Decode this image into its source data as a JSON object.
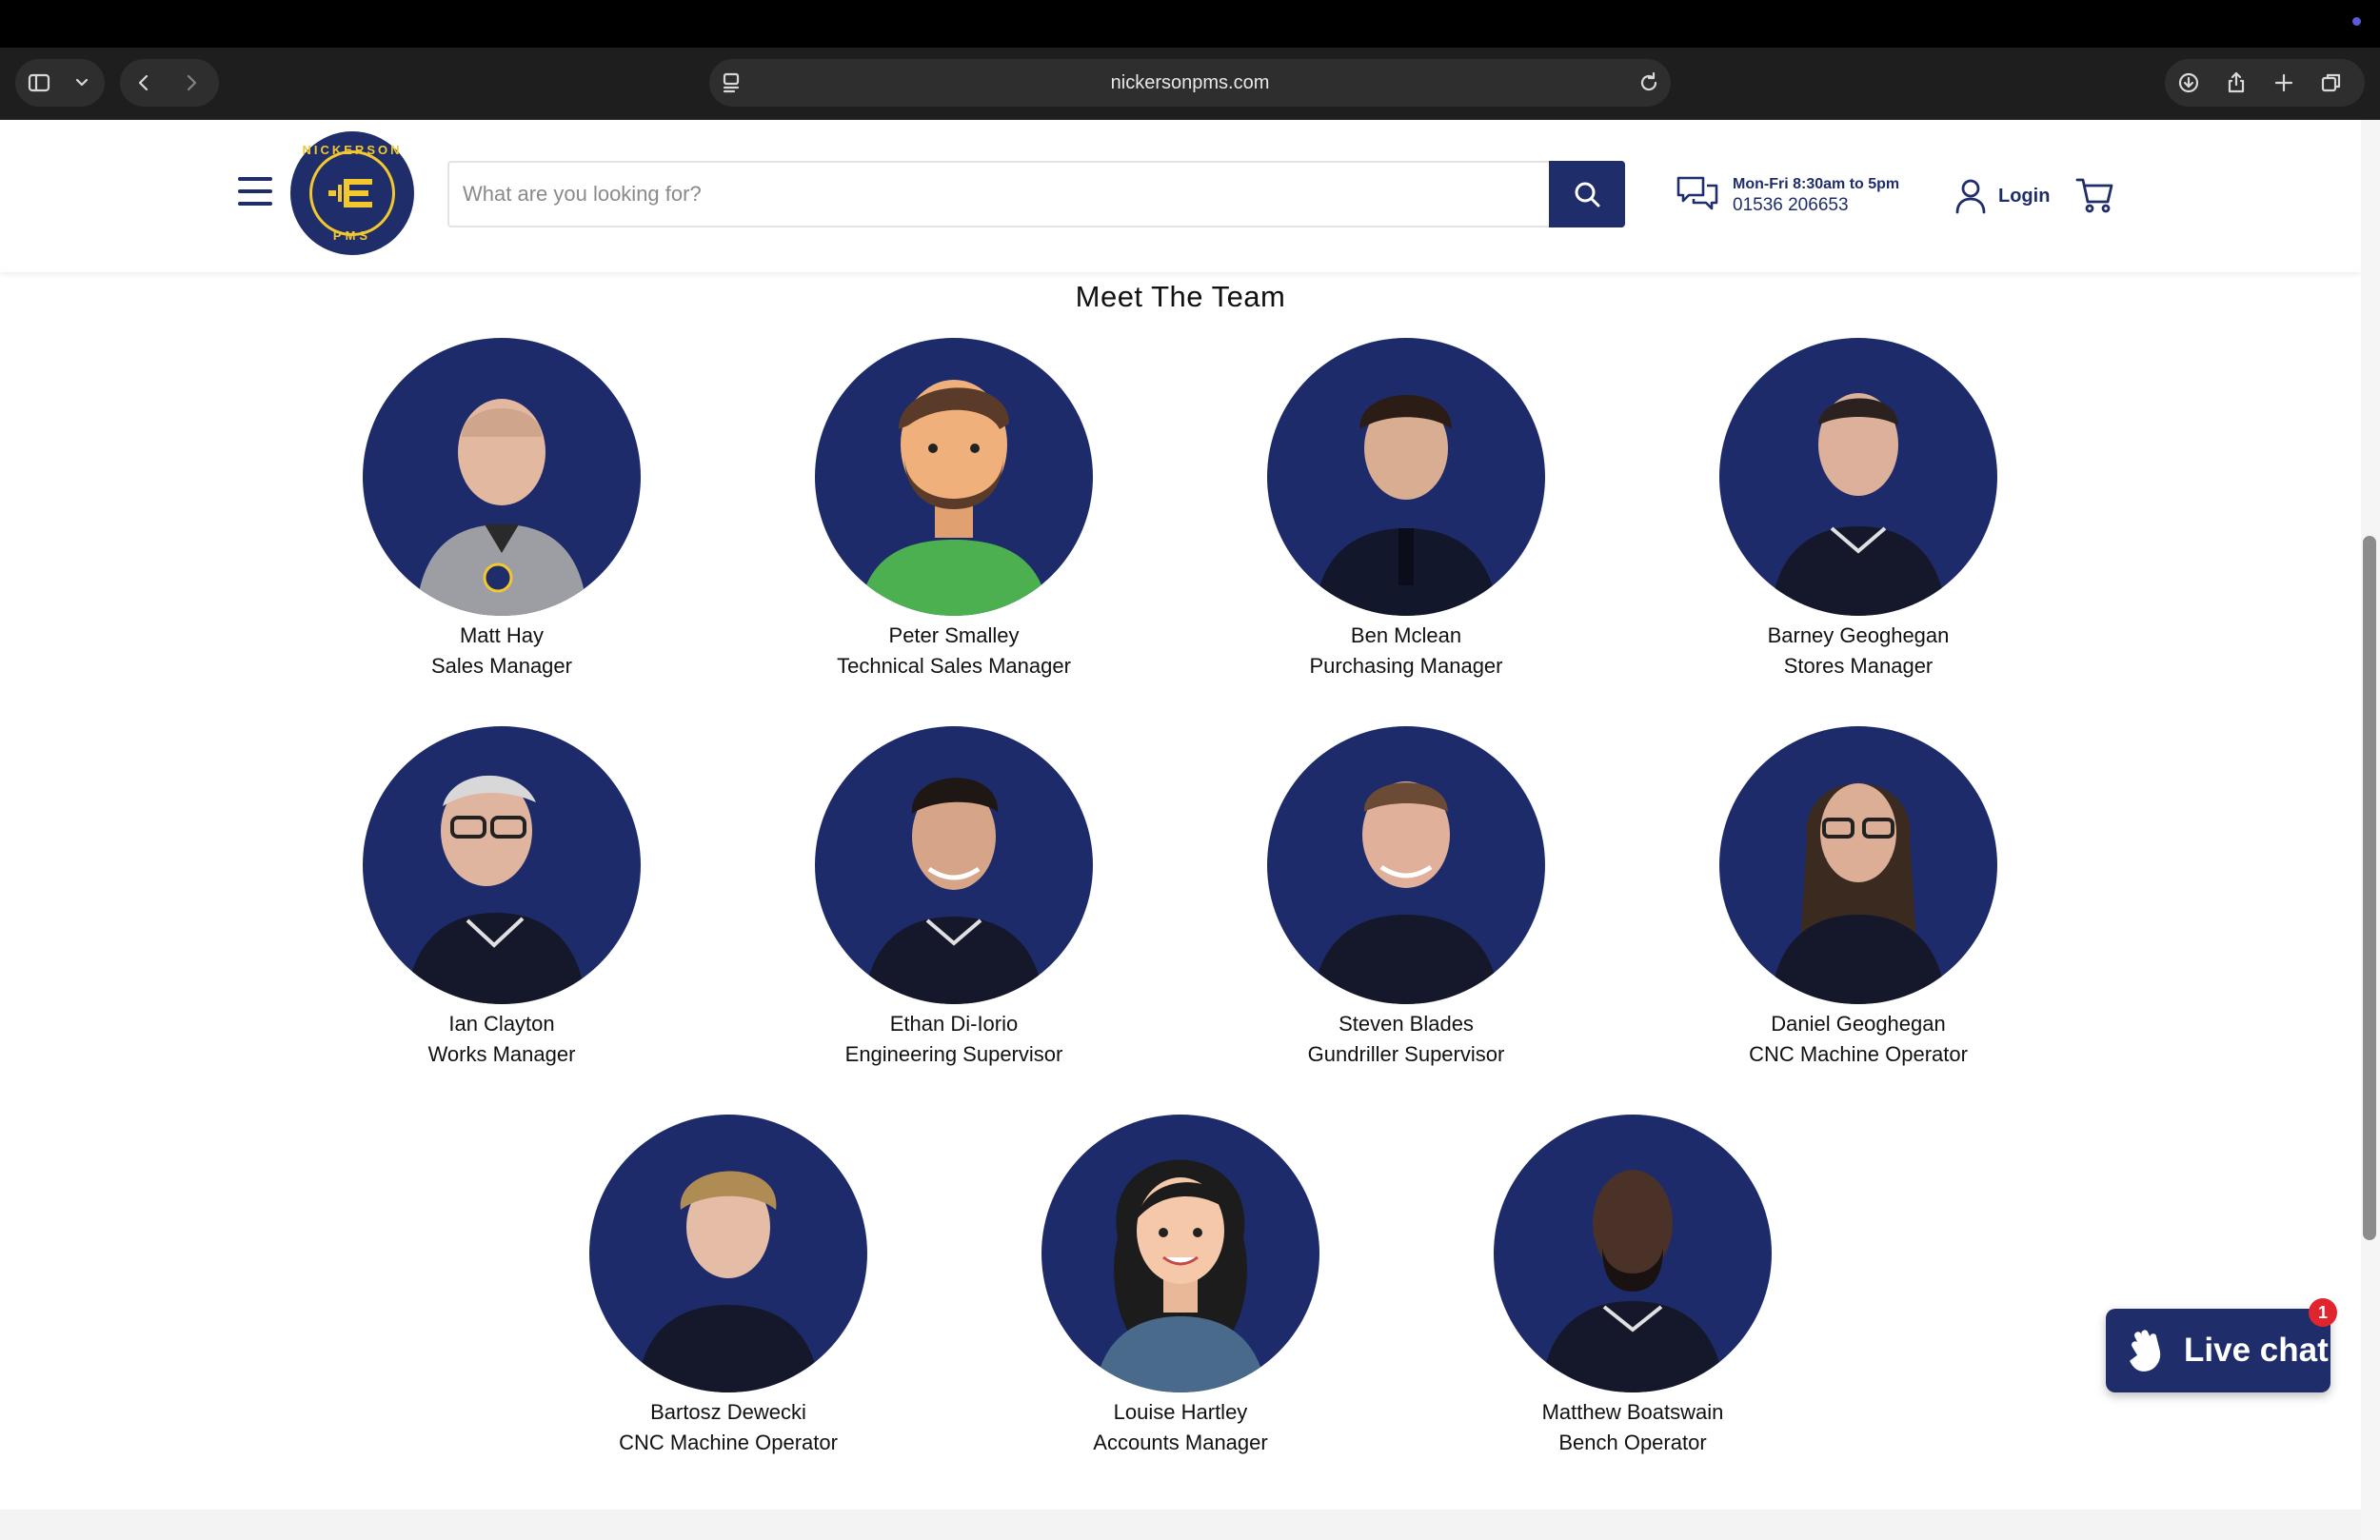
{
  "browser": {
    "url": "nickersonpms.com"
  },
  "header": {
    "logo_top": "NICKERSON",
    "logo_bottom": "PMS",
    "search_placeholder": "What are you looking for?",
    "contact_hours": "Mon-Fri 8:30am to 5pm",
    "contact_phone": "01536 206653",
    "login_label": "Login"
  },
  "main": {
    "section_title": "Meet The Team",
    "members": [
      {
        "name": "Matt Hay",
        "role": "Sales Manager"
      },
      {
        "name": "Peter Smalley",
        "role": "Technical Sales Manager"
      },
      {
        "name": "Ben Mclean",
        "role": "Purchasing Manager"
      },
      {
        "name": "Barney Geoghegan",
        "role": "Stores Manager"
      },
      {
        "name": "Ian Clayton",
        "role": "Works Manager"
      },
      {
        "name": "Ethan Di-Iorio",
        "role": "Engineering Supervisor"
      },
      {
        "name": "Steven Blades",
        "role": "Gundriller Supervisor"
      },
      {
        "name": "Daniel Geoghegan",
        "role": "CNC Machine Operator"
      },
      {
        "name": "Bartosz Dewecki",
        "role": "CNC Machine Operator"
      },
      {
        "name": "Louise Hartley",
        "role": "Accounts Manager"
      },
      {
        "name": "Matthew Boatswain",
        "role": "Bench Operator"
      }
    ]
  },
  "live_chat": {
    "label": "Live chat",
    "badge_count": "1"
  },
  "colors": {
    "brand_navy": "#1f2d6b",
    "brand_yellow": "#f2c82e",
    "badge_red": "#e1252f"
  }
}
